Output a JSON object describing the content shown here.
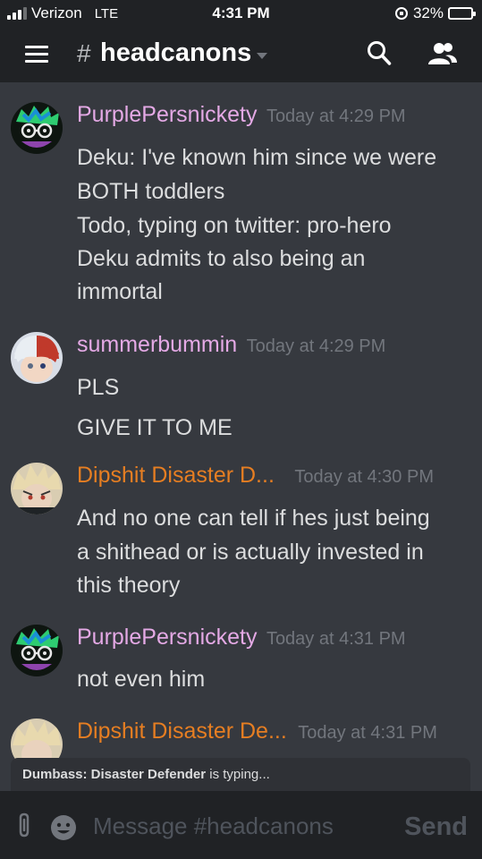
{
  "status_bar": {
    "carrier": "Verizon",
    "network": "LTE",
    "time": "4:31 PM",
    "battery": "32%",
    "battery_level": 0.32
  },
  "header": {
    "hash": "#",
    "channel": "headcanons"
  },
  "messages": [
    {
      "username": "PurplePersnickety",
      "timestamp": "Today at 4:29 PM",
      "color": "#e4a9e5",
      "lines": [
        "Deku: I've known him since we were",
        "BOTH toddlers",
        "Todo, typing on twitter: pro-hero",
        "Deku admits to also being an",
        "immortal"
      ]
    },
    {
      "username": "summerbummin",
      "timestamp": "Today at 4:29 PM",
      "color": "#e4a9e5",
      "lines": [
        "PLS",
        "GIVE IT TO ME"
      ]
    },
    {
      "username": "Dipshit Disaster D...",
      "timestamp": "Today at 4:30 PM",
      "color": "#e67e22",
      "lines": [
        "And no one can tell if hes just being",
        "a shithead or is actually invested in",
        "this theory"
      ]
    },
    {
      "username": "PurplePersnickety",
      "timestamp": "Today at 4:31 PM",
      "color": "#e4a9e5",
      "lines": [
        "not even him"
      ]
    },
    {
      "username": "Dipshit Disaster De...",
      "timestamp": "Today at 4:31 PM",
      "color": "#e67e22",
      "lines": []
    }
  ],
  "typing": {
    "name": "Dumbass: Disaster Defender",
    "suffix": "is typing..."
  },
  "composer": {
    "placeholder": "Message #headcanons",
    "send_label": "Send"
  },
  "icons": {
    "menu": "hamburger-menu-icon",
    "search": "search-icon",
    "members": "members-icon",
    "attach": "paperclip-icon",
    "emoji": "emoji-icon",
    "lock": "rotation-lock-icon",
    "battery": "battery-icon",
    "signal": "signal-icon"
  },
  "colors": {
    "background": "#36393f",
    "header": "#202225",
    "username_pink": "#e4a9e5",
    "username_orange": "#e67e22",
    "text": "#dcddde",
    "timestamp": "#72767d"
  }
}
